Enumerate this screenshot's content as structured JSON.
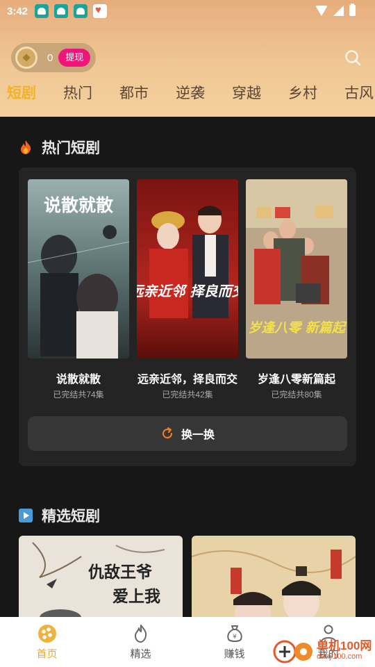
{
  "status_bar": {
    "time": "3:42"
  },
  "header": {
    "coin_count": "0",
    "withdraw_label": "提现",
    "search_icon": "search-icon"
  },
  "tabs": [
    {
      "label": "短剧",
      "active": true
    },
    {
      "label": "热门"
    },
    {
      "label": "都市"
    },
    {
      "label": "逆袭"
    },
    {
      "label": "穿越"
    },
    {
      "label": "乡村"
    },
    {
      "label": "古风"
    }
  ],
  "hot_section": {
    "title": "热门短剧",
    "icon": "flame-icon",
    "dramas": [
      {
        "title": "说散就散",
        "status": "已完结共74集",
        "poster_text": "说散就散"
      },
      {
        "title": "远亲近邻，择良而交",
        "status": "已完结共42集",
        "poster_text": "远亲近邻 择良而交"
      },
      {
        "title": "岁逢八零新篇起",
        "status": "已完结共80集",
        "poster_text": "岁逢八零 新篇起"
      }
    ],
    "refresh_label": "换一换"
  },
  "picks_section": {
    "title": "精选短剧",
    "icon": "play-icon",
    "items": [
      {
        "poster_text": "仇敌王爷爱上我"
      },
      {
        "poster_text": ""
      }
    ]
  },
  "bottom_nav": [
    {
      "label": "首页",
      "icon": "home-icon",
      "active": true
    },
    {
      "label": "精选",
      "icon": "flame-outline-icon"
    },
    {
      "label": "赚钱",
      "icon": "money-bag-icon"
    },
    {
      "label": "我的",
      "icon": "profile-icon"
    }
  ],
  "watermark": {
    "text": "单机100网",
    "url": "danji100.com"
  },
  "colors": {
    "accent": "#f2b22a",
    "withdraw": "#f0157a",
    "background": "#171717",
    "card": "#242424"
  }
}
